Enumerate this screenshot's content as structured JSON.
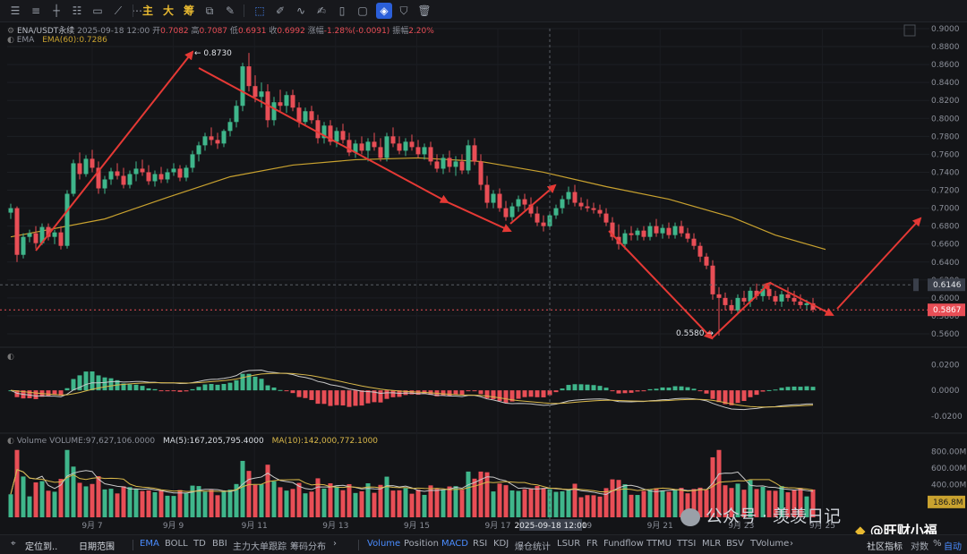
{
  "toolbar": {
    "icons": [
      "sliders-icon",
      "sliders-alt-icon",
      "crosshair-line-icon",
      "lines-icon",
      "rectangle-icon",
      "trend-line-icon",
      "more-dots-icon",
      "indicator-main-icon",
      "indicator-big-icon",
      "indicator-chip-icon",
      "copy-icon",
      "edit-icon",
      "cursor-icon",
      "ruler-icon",
      "brush-icon",
      "clipboard-icon",
      "text-box-icon",
      "magnet-icon",
      "filter-icon",
      "trash-icon"
    ],
    "labels": {
      "main": "主",
      "big": "大",
      "chip": "筹"
    }
  },
  "header": {
    "symbol": "ENA/USDT永续",
    "datetime": "2025-09-18 12:00",
    "open_label": "开",
    "open": "0.7082",
    "high_label": "高",
    "high": "0.7087",
    "low_label": "低",
    "low": "0.6931",
    "close_label": "收",
    "close": "0.6992",
    "change_label": "涨幅",
    "change": "-1.28%(-0.0091)",
    "amp_label": "振幅",
    "amp": "2.20%",
    "ema_name": "EMA",
    "ema_label": "EMA(60):",
    "ema_value": "0.7286"
  },
  "volume_header": {
    "volume_label": "Volume",
    "volume_value": "VOLUME:97,627,106.0000",
    "ma5": "MA(5):167,205,795.4000",
    "ma10": "MA(10):142,000,772.1000"
  },
  "colors": {
    "up": "#3fb68b",
    "down": "#e84e56",
    "ema": "#c9a22f",
    "ma5": "#c9c9c9",
    "ma10": "#d9b84a",
    "arrow": "#e53935",
    "price_tag": "#e84e56",
    "crosshair_tag": "#3a3f4a"
  },
  "chart_data": {
    "type": "candlestick",
    "price_axis": {
      "ticks": [
        "0.9000",
        "0.8800",
        "0.8600",
        "0.8400",
        "0.8200",
        "0.8000",
        "0.7800",
        "0.7600",
        "0.7400",
        "0.7200",
        "0.7000",
        "0.6800",
        "0.6600",
        "0.6400",
        "0.6200",
        "0.6000",
        "0.5800",
        "0.5600"
      ],
      "range": [
        0.555,
        0.9
      ]
    },
    "x_axis": {
      "ticks": [
        "9月 7",
        "9月 9",
        "9月 11",
        "9月 13",
        "9月 15",
        "9月 17",
        "9月 19",
        "9月 21",
        "9月 23",
        "9月 25"
      ],
      "crosshair_label": "2025-09-18 12:00"
    },
    "current_price": "0.5867",
    "crosshair_price": "0.6146",
    "annotations": {
      "high": "← 0.8730",
      "low": "0.5580 →"
    },
    "candles": [
      [
        0.695,
        0.705,
        0.688,
        0.7
      ],
      [
        0.7,
        0.702,
        0.64,
        0.648
      ],
      [
        0.648,
        0.672,
        0.644,
        0.668
      ],
      [
        0.668,
        0.676,
        0.662,
        0.672
      ],
      [
        0.672,
        0.68,
        0.655,
        0.661
      ],
      [
        0.661,
        0.683,
        0.659,
        0.679
      ],
      [
        0.679,
        0.683,
        0.664,
        0.668
      ],
      [
        0.668,
        0.676,
        0.66,
        0.673
      ],
      [
        0.673,
        0.68,
        0.654,
        0.658
      ],
      [
        0.658,
        0.72,
        0.655,
        0.716
      ],
      [
        0.716,
        0.754,
        0.713,
        0.75
      ],
      [
        0.75,
        0.762,
        0.732,
        0.738
      ],
      [
        0.738,
        0.759,
        0.735,
        0.755
      ],
      [
        0.755,
        0.765,
        0.74,
        0.745
      ],
      [
        0.745,
        0.752,
        0.716,
        0.722
      ],
      [
        0.722,
        0.736,
        0.716,
        0.732
      ],
      [
        0.732,
        0.745,
        0.726,
        0.741
      ],
      [
        0.741,
        0.75,
        0.732,
        0.736
      ],
      [
        0.736,
        0.745,
        0.722,
        0.726
      ],
      [
        0.726,
        0.742,
        0.722,
        0.738
      ],
      [
        0.738,
        0.752,
        0.73,
        0.744
      ],
      [
        0.744,
        0.754,
        0.736,
        0.74
      ],
      [
        0.74,
        0.748,
        0.726,
        0.73
      ],
      [
        0.73,
        0.742,
        0.724,
        0.738
      ],
      [
        0.738,
        0.746,
        0.728,
        0.732
      ],
      [
        0.732,
        0.744,
        0.728,
        0.74
      ],
      [
        0.74,
        0.75,
        0.736,
        0.744
      ],
      [
        0.744,
        0.748,
        0.73,
        0.734
      ],
      [
        0.734,
        0.748,
        0.73,
        0.745
      ],
      [
        0.745,
        0.764,
        0.74,
        0.76
      ],
      [
        0.76,
        0.774,
        0.752,
        0.77
      ],
      [
        0.77,
        0.784,
        0.764,
        0.78
      ],
      [
        0.78,
        0.79,
        0.77,
        0.776
      ],
      [
        0.776,
        0.784,
        0.766,
        0.772
      ],
      [
        0.772,
        0.788,
        0.768,
        0.786
      ],
      [
        0.786,
        0.8,
        0.78,
        0.796
      ],
      [
        0.796,
        0.82,
        0.79,
        0.814
      ],
      [
        0.814,
        0.862,
        0.808,
        0.858
      ],
      [
        0.858,
        0.873,
        0.83,
        0.836
      ],
      [
        0.836,
        0.848,
        0.818,
        0.824
      ],
      [
        0.824,
        0.84,
        0.812,
        0.83
      ],
      [
        0.83,
        0.838,
        0.79,
        0.798
      ],
      [
        0.798,
        0.824,
        0.792,
        0.818
      ],
      [
        0.818,
        0.832,
        0.808,
        0.814
      ],
      [
        0.814,
        0.83,
        0.806,
        0.826
      ],
      [
        0.826,
        0.832,
        0.808,
        0.812
      ],
      [
        0.812,
        0.818,
        0.79,
        0.796
      ],
      [
        0.796,
        0.812,
        0.792,
        0.808
      ],
      [
        0.808,
        0.814,
        0.794,
        0.798
      ],
      [
        0.798,
        0.804,
        0.772,
        0.778
      ],
      [
        0.778,
        0.796,
        0.772,
        0.792
      ],
      [
        0.792,
        0.798,
        0.77,
        0.774
      ],
      [
        0.774,
        0.79,
        0.768,
        0.786
      ],
      [
        0.786,
        0.794,
        0.772,
        0.776
      ],
      [
        0.776,
        0.784,
        0.758,
        0.762
      ],
      [
        0.762,
        0.776,
        0.756,
        0.772
      ],
      [
        0.772,
        0.78,
        0.76,
        0.764
      ],
      [
        0.764,
        0.778,
        0.752,
        0.774
      ],
      [
        0.774,
        0.784,
        0.764,
        0.768
      ],
      [
        0.768,
        0.778,
        0.752,
        0.756
      ],
      [
        0.756,
        0.784,
        0.752,
        0.78
      ],
      [
        0.78,
        0.79,
        0.768,
        0.772
      ],
      [
        0.772,
        0.78,
        0.76,
        0.764
      ],
      [
        0.764,
        0.778,
        0.758,
        0.774
      ],
      [
        0.774,
        0.782,
        0.764,
        0.768
      ],
      [
        0.768,
        0.776,
        0.756,
        0.76
      ],
      [
        0.76,
        0.772,
        0.754,
        0.768
      ],
      [
        0.768,
        0.774,
        0.748,
        0.752
      ],
      [
        0.752,
        0.76,
        0.74,
        0.744
      ],
      [
        0.744,
        0.76,
        0.738,
        0.756
      ],
      [
        0.756,
        0.764,
        0.74,
        0.746
      ],
      [
        0.746,
        0.758,
        0.736,
        0.752
      ],
      [
        0.752,
        0.76,
        0.738,
        0.742
      ],
      [
        0.742,
        0.776,
        0.738,
        0.77
      ],
      [
        0.77,
        0.778,
        0.748,
        0.752
      ],
      [
        0.752,
        0.76,
        0.72,
        0.726
      ],
      [
        0.726,
        0.736,
        0.7,
        0.706
      ],
      [
        0.706,
        0.72,
        0.7,
        0.716
      ],
      [
        0.716,
        0.722,
        0.696,
        0.7
      ],
      [
        0.7,
        0.708,
        0.686,
        0.69
      ],
      [
        0.69,
        0.706,
        0.686,
        0.702
      ],
      [
        0.702,
        0.714,
        0.696,
        0.71
      ],
      [
        0.71,
        0.716,
        0.698,
        0.704
      ],
      [
        0.704,
        0.712,
        0.69,
        0.694
      ],
      [
        0.694,
        0.702,
        0.68,
        0.684
      ],
      [
        0.684,
        0.692,
        0.674,
        0.68
      ],
      [
        0.68,
        0.696,
        0.676,
        0.692
      ],
      [
        0.692,
        0.704,
        0.688,
        0.7
      ],
      [
        0.7,
        0.714,
        0.694,
        0.71
      ],
      [
        0.71,
        0.724,
        0.704,
        0.718
      ],
      [
        0.718,
        0.726,
        0.702,
        0.706
      ],
      [
        0.706,
        0.712,
        0.698,
        0.702
      ],
      [
        0.702,
        0.71,
        0.696,
        0.7
      ],
      [
        0.7,
        0.706,
        0.694,
        0.698
      ],
      [
        0.698,
        0.704,
        0.69,
        0.694
      ],
      [
        0.694,
        0.7,
        0.68,
        0.684
      ],
      [
        0.684,
        0.69,
        0.664,
        0.668
      ],
      [
        0.668,
        0.682,
        0.654,
        0.66
      ],
      [
        0.66,
        0.676,
        0.654,
        0.672
      ],
      [
        0.672,
        0.68,
        0.664,
        0.67
      ],
      [
        0.67,
        0.678,
        0.664,
        0.675
      ],
      [
        0.675,
        0.68,
        0.664,
        0.668
      ],
      [
        0.668,
        0.684,
        0.664,
        0.68
      ],
      [
        0.68,
        0.688,
        0.668,
        0.672
      ],
      [
        0.672,
        0.682,
        0.666,
        0.678
      ],
      [
        0.678,
        0.684,
        0.666,
        0.67
      ],
      [
        0.67,
        0.684,
        0.666,
        0.68
      ],
      [
        0.68,
        0.686,
        0.668,
        0.672
      ],
      [
        0.672,
        0.678,
        0.662,
        0.666
      ],
      [
        0.666,
        0.672,
        0.654,
        0.658
      ],
      [
        0.658,
        0.662,
        0.64,
        0.646
      ],
      [
        0.646,
        0.65,
        0.632,
        0.636
      ],
      [
        0.636,
        0.642,
        0.598,
        0.604
      ],
      [
        0.604,
        0.612,
        0.558,
        0.6
      ],
      [
        0.6,
        0.606,
        0.586,
        0.592
      ],
      [
        0.592,
        0.598,
        0.582,
        0.586
      ],
      [
        0.586,
        0.604,
        0.582,
        0.6
      ],
      [
        0.6,
        0.608,
        0.592,
        0.596
      ],
      [
        0.596,
        0.612,
        0.59,
        0.608
      ],
      [
        0.608,
        0.616,
        0.598,
        0.602
      ],
      [
        0.602,
        0.614,
        0.596,
        0.61
      ],
      [
        0.61,
        0.616,
        0.598,
        0.602
      ],
      [
        0.602,
        0.608,
        0.592,
        0.596
      ],
      [
        0.596,
        0.608,
        0.59,
        0.604
      ],
      [
        0.604,
        0.612,
        0.596,
        0.6
      ],
      [
        0.6,
        0.608,
        0.592,
        0.596
      ],
      [
        0.596,
        0.604,
        0.588,
        0.592
      ],
      [
        0.592,
        0.598,
        0.586,
        0.594
      ],
      [
        0.594,
        0.6,
        0.584,
        0.587
      ]
    ],
    "ema60": [
      [
        0,
        0.668
      ],
      [
        15,
        0.688
      ],
      [
        25,
        0.712
      ],
      [
        35,
        0.735
      ],
      [
        45,
        0.748
      ],
      [
        55,
        0.754
      ],
      [
        65,
        0.756
      ],
      [
        75,
        0.752
      ],
      [
        85,
        0.74
      ],
      [
        95,
        0.724
      ],
      [
        105,
        0.71
      ],
      [
        115,
        0.69
      ],
      [
        122,
        0.67
      ],
      [
        130,
        0.654
      ]
    ],
    "macd": {
      "ticks": [
        "0.0200",
        "0.0000",
        "-0.0200"
      ],
      "range": [
        -0.032,
        0.028
      ]
    },
    "volume": {
      "ticks": [
        "800.00M",
        "600.00M",
        "400.00M"
      ],
      "range": [
        0,
        850
      ],
      "current_label": "186.8M"
    }
  },
  "watermark": {
    "wechat": "公众号 · 羡羡日记",
    "brand": "@旺财小福"
  },
  "bottombar": {
    "left": [
      {
        "id": "locate",
        "label": "定位到..",
        "bold": true
      },
      {
        "id": "date-range",
        "label": "日期范围",
        "bold": true
      }
    ],
    "main": [
      {
        "id": "ema",
        "label": "EMA",
        "on": true
      },
      {
        "id": "boll",
        "label": "BOLL"
      },
      {
        "id": "td",
        "label": "TD"
      },
      {
        "id": "bbi",
        "label": "BBI"
      },
      {
        "id": "main-force",
        "label": "主力大单跟踪"
      },
      {
        "id": "chip-dist",
        "label": "筹码分布"
      }
    ],
    "sub": [
      {
        "id": "volume",
        "label": "Volume",
        "on": true
      },
      {
        "id": "position",
        "label": "Position"
      },
      {
        "id": "macd",
        "label": "MACD",
        "on": true
      },
      {
        "id": "rsi",
        "label": "RSI"
      },
      {
        "id": "kdj",
        "label": "KDJ"
      },
      {
        "id": "liq",
        "label": "爆仓统计"
      },
      {
        "id": "lsur",
        "label": "LSUR"
      },
      {
        "id": "fr",
        "label": "FR"
      },
      {
        "id": "fundflow",
        "label": "Fundflow"
      },
      {
        "id": "ttmu",
        "label": "TTMU"
      },
      {
        "id": "ttsi",
        "label": "TTSI"
      },
      {
        "id": "mlr",
        "label": "MLR"
      },
      {
        "id": "bsv",
        "label": "BSV"
      },
      {
        "id": "tvolume",
        "label": "TVolume"
      }
    ],
    "right": {
      "community": "社区指标",
      "log": "对数",
      "percent": "%",
      "auto": "自动"
    }
  }
}
